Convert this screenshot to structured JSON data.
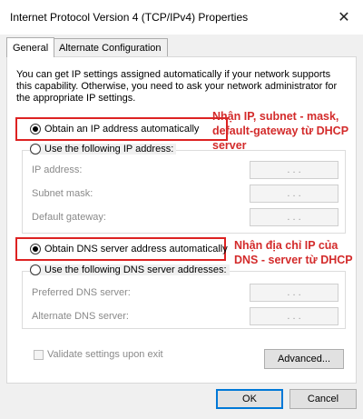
{
  "window": {
    "title": "Internet Protocol Version 4 (TCP/IPv4) Properties",
    "close_glyph": "✕"
  },
  "tabs": [
    {
      "label": "General",
      "active": true
    },
    {
      "label": "Alternate Configuration",
      "active": false
    }
  ],
  "description": "You can get IP settings assigned automatically if your network supports this capability. Otherwise, you need to ask your network administrator for the appropriate IP settings.",
  "ip_section": {
    "auto_label": "Obtain an IP address automatically",
    "manual_label": "Use the following IP address:",
    "fields": [
      {
        "label": "IP address:",
        "value": ". . ."
      },
      {
        "label": "Subnet mask:",
        "value": ". . ."
      },
      {
        "label": "Default gateway:",
        "value": ". . ."
      }
    ],
    "annotation": "Nhận IP, subnet - mask, default-gateway từ DHCP server"
  },
  "dns_section": {
    "auto_label": "Obtain DNS server address automatically",
    "manual_label": "Use the following DNS server addresses:",
    "fields": [
      {
        "label": "Preferred DNS server:",
        "value": ". . ."
      },
      {
        "label": "Alternate DNS server:",
        "value": ". . ."
      }
    ],
    "annotation": "Nhận địa chỉ IP của DNS - server từ DHCP"
  },
  "validate_label": "Validate settings upon exit",
  "buttons": {
    "advanced": "Advanced...",
    "ok": "OK",
    "cancel": "Cancel"
  },
  "colors": {
    "annotation": "#d32b2b",
    "dialog_bg": "#f0f0f0",
    "ok_border": "#0078d7"
  }
}
